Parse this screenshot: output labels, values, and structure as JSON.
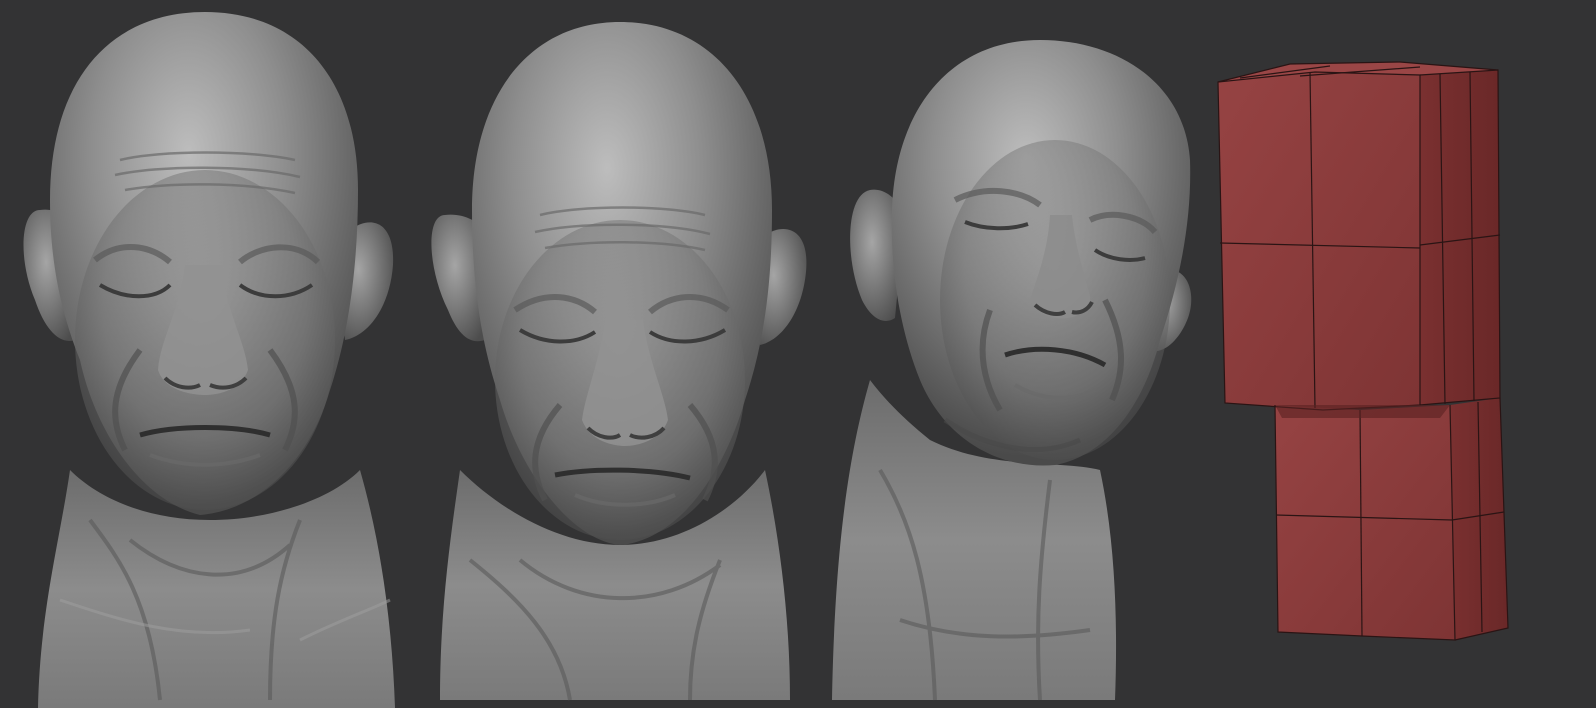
{
  "scene": {
    "background_color": "#333334",
    "models": [
      {
        "kind": "sculpted-bust",
        "view": "front",
        "material_color": "#8a8a8a",
        "expression": "eyes-closed"
      },
      {
        "kind": "sculpted-bust",
        "view": "front-down",
        "material_color": "#8a8a8a",
        "expression": "eyes-closed"
      },
      {
        "kind": "sculpted-bust",
        "view": "three-quarter",
        "material_color": "#8a8a8a",
        "expression": "eyes-closed"
      },
      {
        "kind": "base-mesh-blockout",
        "view": "three-quarter",
        "material_color": "#8b3b3b",
        "wire_color": "#2a1414"
      }
    ]
  }
}
